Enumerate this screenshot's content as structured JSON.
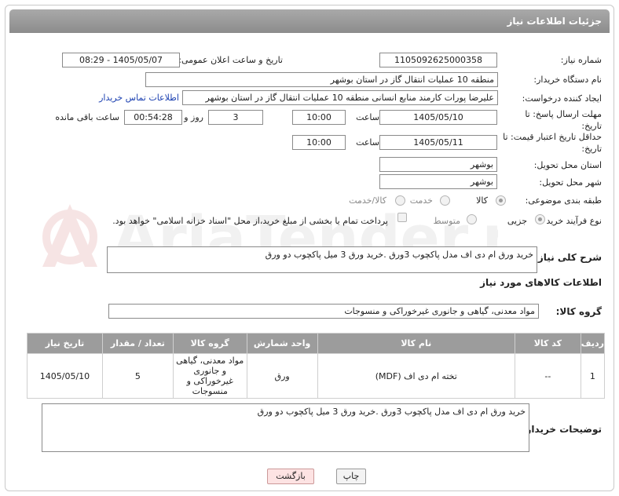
{
  "page": {
    "title": "جزئیات اطلاعات نیاز",
    "watermark_text": "AriaTender.net"
  },
  "fields": {
    "need_number_label": "شماره نیاز:",
    "need_number": "1105092625000358",
    "announce_label": "تاریخ و ساعت اعلان عمومی:",
    "announce_value": "1405/05/07 - 08:29",
    "buyer_label": "نام دستگاه خریدار:",
    "buyer_value": "منطقه 10 عملیات انتقال گاز در استان بوشهر",
    "creator_label": "ایجاد کننده درخواست:",
    "creator_value": "علیرضا پورات کارمند منابع انسانی منطقه 10 عملیات انتقال گاز در استان بوشهر",
    "contact_link": "اطلاعات تماس خریدار",
    "deadline_label": "مهلت ارسال پاسخ: تا تاریخ:",
    "deadline_date": "1405/05/10",
    "time_label": "ساعت",
    "deadline_time": "10:00",
    "days_value": "3",
    "days_label": "روز و",
    "remaining_value": "00:54:28",
    "remaining_label": "ساعت باقی مانده",
    "price_label": "حداقل تاریخ اعتبار قیمت: تا تاریخ:",
    "price_date": "1405/05/11",
    "price_time": "10:00",
    "province_label": "استان محل تحویل:",
    "province_value": "بوشهر",
    "city_label": "شهر محل تحویل:",
    "city_value": "بوشهر",
    "category_label": "طبقه بندی موضوعی:",
    "category_options": [
      "کالا",
      "خدمت",
      "کالا/خدمت"
    ],
    "process_label": "نوع فرآیند خرید :",
    "process_options": [
      "جزیی",
      "متوسط"
    ],
    "payment_note": "پرداخت تمام یا بخشی از مبلغ خرید،از محل \"اسناد خزانه اسلامی\" خواهد بود."
  },
  "description": {
    "label": "شرح کلی نیاز:",
    "value": "خرید ورق ام دی اف مدل پاکچوب 3ورق .خرید ورق 3 میل پاکچوب دو ورق"
  },
  "goods": {
    "section_title": "اطلاعات کالاهای مورد نیاز",
    "group_label": "گروه کالا:",
    "group_value": "مواد معدنی، گیاهی و جانوری غیرخوراکی و منسوجات",
    "columns": [
      "ردیف",
      "کد کالا",
      "نام کالا",
      "واحد شمارش",
      "گروه کالا",
      "تعداد / مقدار",
      "تاریخ نیاز"
    ],
    "rows": [
      {
        "row": "1",
        "code": "--",
        "name": "تخته ام دی اف (MDF)",
        "unit": "ورق",
        "group": "مواد معدنی، گیاهی و جانوری غیرخوراکی و منسوجات",
        "qty": "5",
        "date": "1405/05/10"
      }
    ]
  },
  "buyer_notes": {
    "label": "توضیحات خریدار:",
    "value": "خرید ورق ام دی اف مدل پاکچوب 3ورق .خرید ورق 3 میل پاکچوب دو ورق"
  },
  "buttons": {
    "print": "چاپ",
    "back": "بازگشت"
  }
}
